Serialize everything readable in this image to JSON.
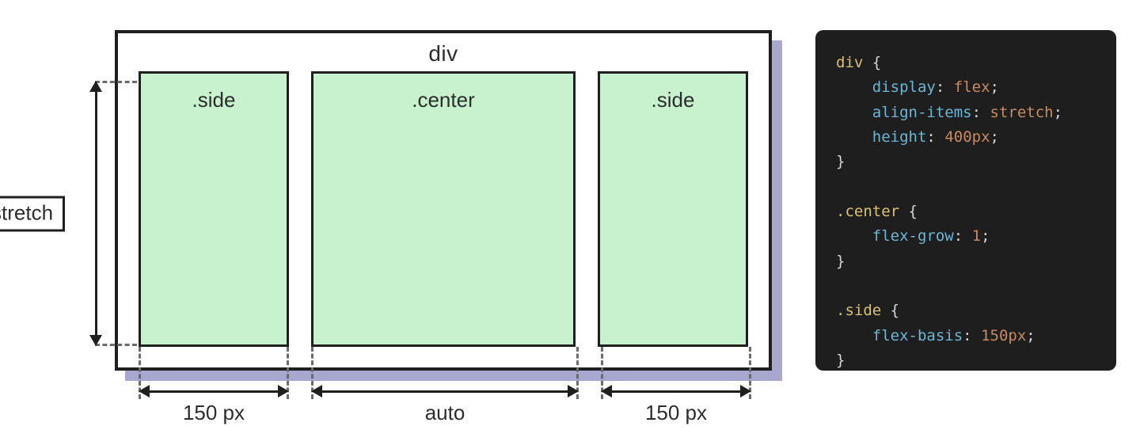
{
  "diagram": {
    "container_label": "div",
    "children": {
      "side_left": ".side",
      "center": ".center",
      "side_right": ".side"
    },
    "v_measure": {
      "label": "stretch"
    },
    "h_measures": {
      "side_left": "150 px",
      "center": "auto",
      "side_right": "150 px"
    }
  },
  "code": {
    "rules": [
      {
        "selector": "div",
        "props": [
          {
            "name": "display",
            "value": "flex"
          },
          {
            "name": "align-items",
            "value": "stretch"
          },
          {
            "name": "height",
            "value": "400px"
          }
        ]
      },
      {
        "selector": ".center",
        "props": [
          {
            "name": "flex-grow",
            "value": "1"
          }
        ]
      },
      {
        "selector": ".side",
        "props": [
          {
            "name": "flex-basis",
            "value": "150px"
          }
        ]
      }
    ]
  }
}
